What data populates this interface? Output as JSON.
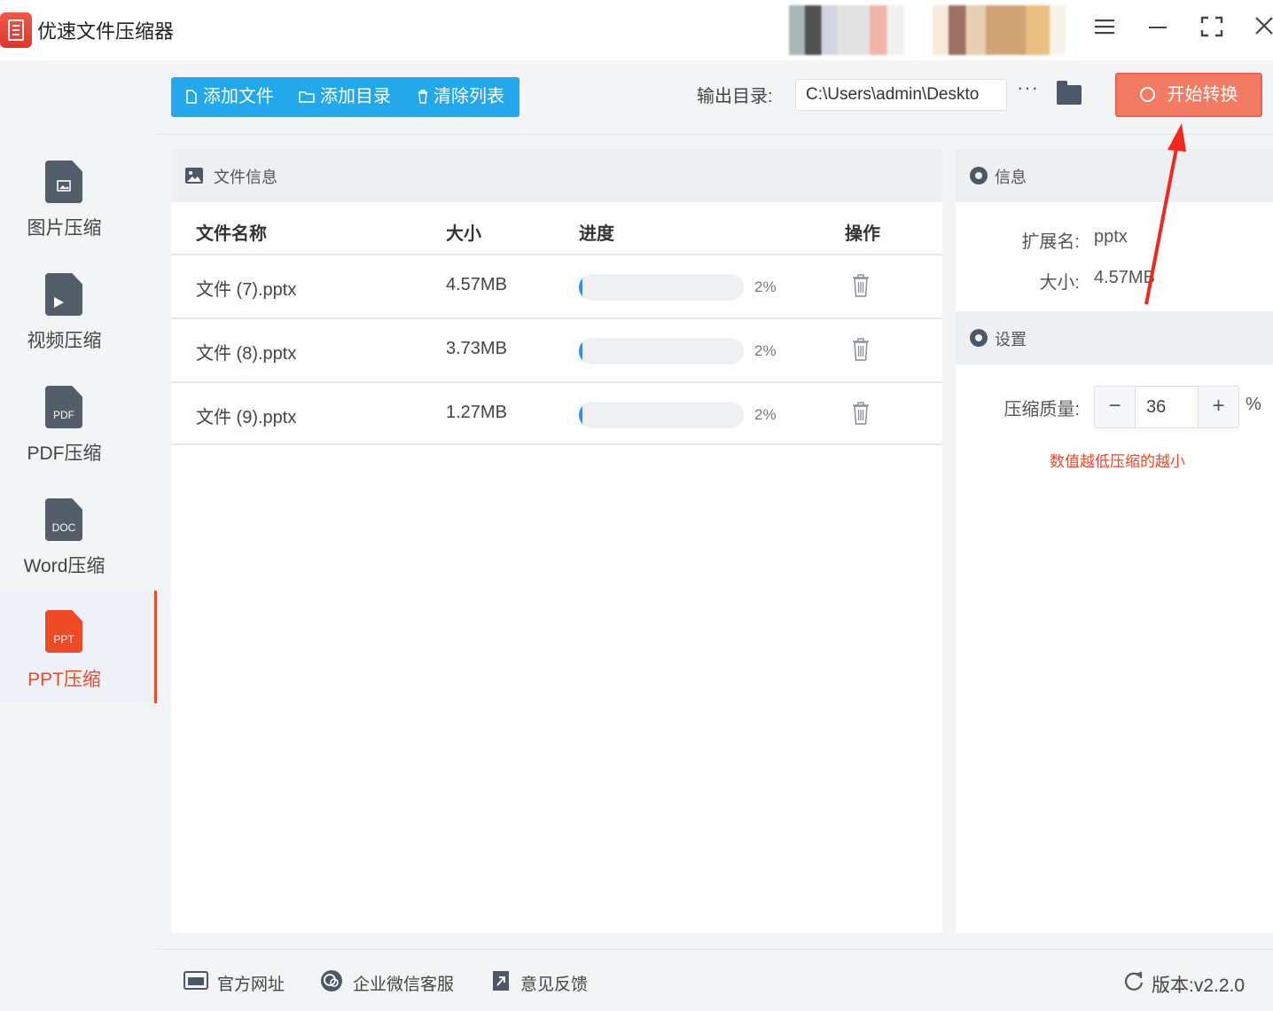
{
  "window": {
    "title": "优速文件压缩器",
    "controls": [
      "menu-icon",
      "minimize-icon",
      "maximize-icon",
      "close-icon"
    ]
  },
  "sidebar": {
    "items": [
      {
        "label": "图片压缩",
        "icon": "image-file-icon",
        "icon_text": "",
        "active": false
      },
      {
        "label": "视频压缩",
        "icon": "video-file-icon",
        "icon_text": "",
        "active": false
      },
      {
        "label": "PDF压缩",
        "icon": "pdf-file-icon",
        "icon_text": "PDF",
        "active": false
      },
      {
        "label": "Word压缩",
        "icon": "doc-file-icon",
        "icon_text": "DOC",
        "active": false
      },
      {
        "label": "PPT压缩",
        "icon": "ppt-file-icon",
        "icon_text": "PPT",
        "active": true
      }
    ]
  },
  "toolbar": {
    "add_file": "添加文件",
    "add_dir": "添加目录",
    "clear_list": "清除列表",
    "output_label": "输出目录:",
    "output_path": "C:\\Users\\admin\\Deskto",
    "more": "···",
    "start": "开始转换"
  },
  "file_panel": {
    "title": "文件信息",
    "columns": {
      "name": "文件名称",
      "size": "大小",
      "progress": "进度",
      "action": "操作"
    },
    "rows": [
      {
        "name": "文件 (7).pptx",
        "size": "4.57MB",
        "progress": 0.02,
        "progress_text": "2%"
      },
      {
        "name": "文件 (8).pptx",
        "size": "3.73MB",
        "progress": 0.02,
        "progress_text": "2%"
      },
      {
        "name": "文件 (9).pptx",
        "size": "1.27MB",
        "progress": 0.02,
        "progress_text": "2%"
      }
    ]
  },
  "info_panel": {
    "info_title": "信息",
    "ext_label": "扩展名:",
    "ext_value": "pptx",
    "size_label": "大小:",
    "size_value": "4.57MB",
    "settings_title": "设置",
    "quality_label": "压缩质量:",
    "quality_value": "36",
    "quality_unit": "%",
    "minus": "−",
    "plus": "+",
    "hint": "数值越低压缩的越小"
  },
  "footer": {
    "website": "官方网址",
    "wechat": "企业微信客服",
    "feedback": "意见反馈",
    "version": "版本:v2.2.0"
  },
  "colors": {
    "accent_blue": "#24a8ec",
    "start_button": "#f47b63",
    "active": "#ef4a26",
    "progress": "#2f8ef0",
    "hint": "#e8472a"
  }
}
